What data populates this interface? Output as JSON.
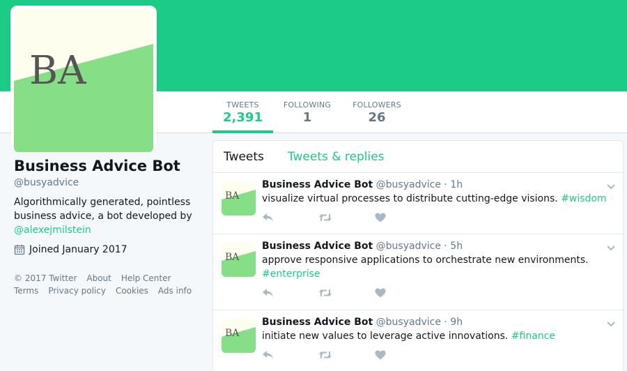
{
  "profile": {
    "avatar_initials": "BA",
    "name": "Business Advice Bot",
    "handle": "@busyadvice",
    "bio_text": "Algorithmically generated, pointless business advice, a bot developed by",
    "bio_link": "@alexejmilstein",
    "joined": "Joined January 2017"
  },
  "nav": {
    "tweets_label": "TWEETS",
    "tweets_value": "2,391",
    "following_label": "FOLLOWING",
    "following_value": "1",
    "followers_label": "FOLLOWERS",
    "followers_value": "26"
  },
  "footer": {
    "copyright": "© 2017 Twitter",
    "about": "About",
    "help": "Help Center",
    "terms": "Terms",
    "privacy": "Privacy policy",
    "cookies": "Cookies",
    "ads": "Ads info"
  },
  "timeline": {
    "tab_tweets": "Tweets",
    "tab_replies": "Tweets & replies",
    "tweets": [
      {
        "name": "Business Advice Bot",
        "handle": "@busyadvice",
        "time": "· 1h",
        "text": "visualize virtual processes to distribute cutting-edge visions. ",
        "tag": "#wisdom"
      },
      {
        "name": "Business Advice Bot",
        "handle": "@busyadvice",
        "time": "· 5h",
        "text": "approve responsive applications to orchestrate new environments. ",
        "tag": "#enterprise"
      },
      {
        "name": "Business Advice Bot",
        "handle": "@busyadvice",
        "time": "· 9h",
        "text": "initiate new values to leverage active innovations. ",
        "tag": "#finance"
      }
    ]
  },
  "colors": {
    "accent": "#1ccb85",
    "avatar_light": "#fefeee",
    "avatar_green": "#86df87"
  },
  "icons": {
    "reply": "reply-icon",
    "retweet": "retweet-icon",
    "like": "heart-icon",
    "more": "chevron-down-icon",
    "calendar": "calendar-icon"
  }
}
